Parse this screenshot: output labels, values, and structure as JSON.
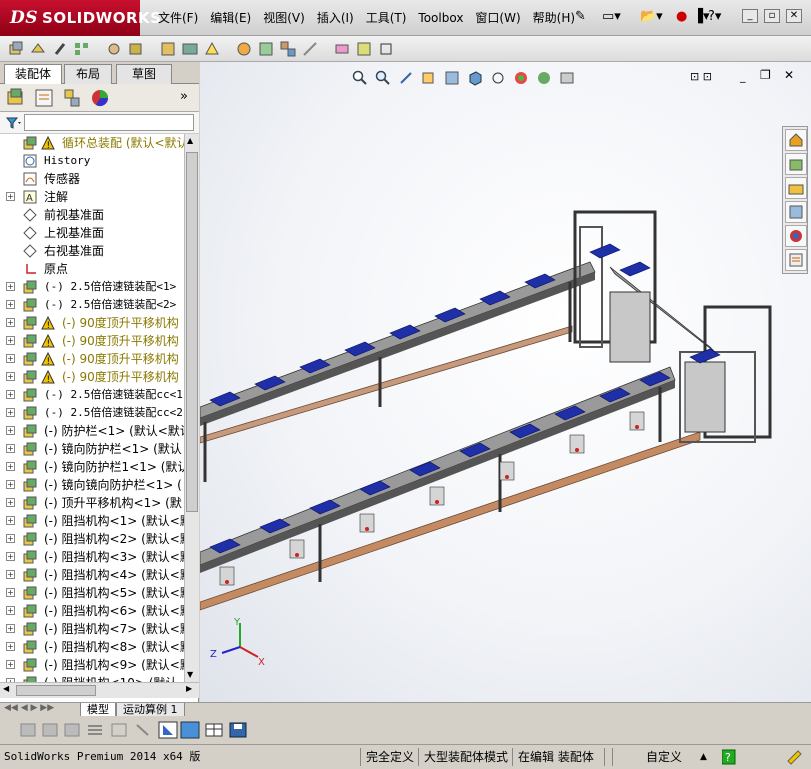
{
  "app": {
    "brand_ds": "DS",
    "brand": "SOLIDWORKS"
  },
  "menu": [
    "文件(F)",
    "编辑(E)",
    "视图(V)",
    "插入(I)",
    "工具(T)",
    "Toolbox",
    "窗口(W)",
    "帮助(H)"
  ],
  "panel_tabs": [
    "装配体",
    "布局",
    "草图"
  ],
  "tree": [
    {
      "label": "循环总装配  (默认<默认_",
      "icon": "assembly-icon",
      "warn": true,
      "exp": "",
      "warnColor": true
    },
    {
      "label": "History",
      "icon": "history-icon",
      "exp": "",
      "mono": true
    },
    {
      "label": "传感器",
      "icon": "sensor-icon",
      "exp": ""
    },
    {
      "label": "注解",
      "icon": "annotation-icon",
      "exp": "+"
    },
    {
      "label": "前视基准面",
      "icon": "plane-icon",
      "exp": ""
    },
    {
      "label": "上视基准面",
      "icon": "plane-icon",
      "exp": ""
    },
    {
      "label": "右视基准面",
      "icon": "plane-icon",
      "exp": ""
    },
    {
      "label": "原点",
      "icon": "origin-icon",
      "exp": ""
    },
    {
      "label": "(-) 2.5倍倍速链装配<1>",
      "icon": "subassembly-icon",
      "exp": "+",
      "mono": true
    },
    {
      "label": "(-) 2.5倍倍速链装配<2>",
      "icon": "subassembly-icon",
      "exp": "+",
      "mono": true
    },
    {
      "label": "(-) 90度顶升平移机构",
      "icon": "subassembly-icon",
      "exp": "+",
      "warn": true,
      "warnColor": true
    },
    {
      "label": "(-) 90度顶升平移机构",
      "icon": "subassembly-icon",
      "exp": "+",
      "warn": true,
      "warnColor": true
    },
    {
      "label": "(-) 90度顶升平移机构",
      "icon": "subassembly-icon",
      "exp": "+",
      "warn": true,
      "warnColor": true
    },
    {
      "label": "(-) 90度顶升平移机构",
      "icon": "subassembly-icon",
      "exp": "+",
      "warn": true,
      "warnColor": true
    },
    {
      "label": "(-) 2.5倍倍速链装配cc<1",
      "icon": "subassembly-icon",
      "exp": "+",
      "mono": true
    },
    {
      "label": "(-) 2.5倍倍速链装配cc<2",
      "icon": "subassembly-icon",
      "exp": "+",
      "mono": true
    },
    {
      "label": "(-) 防护栏<1> (默认<默认",
      "icon": "subassembly-icon",
      "exp": "+"
    },
    {
      "label": "(-) 镜向防护栏<1> (默认",
      "icon": "subassembly-icon",
      "exp": "+"
    },
    {
      "label": "(-) 镜向防护栏1<1> (默认",
      "icon": "subassembly-icon",
      "exp": "+"
    },
    {
      "label": "(-) 镜向镜向防护栏<1> (",
      "icon": "subassembly-icon",
      "exp": "+"
    },
    {
      "label": "(-) 顶升平移机构<1> (默",
      "icon": "subassembly-icon",
      "exp": "+"
    },
    {
      "label": "(-) 阻挡机构<1> (默认<默",
      "icon": "subassembly-icon",
      "exp": "+"
    },
    {
      "label": "(-) 阻挡机构<2> (默认<默",
      "icon": "subassembly-icon",
      "exp": "+"
    },
    {
      "label": "(-) 阻挡机构<3> (默认<默",
      "icon": "subassembly-icon",
      "exp": "+"
    },
    {
      "label": "(-) 阻挡机构<4> (默认<默",
      "icon": "subassembly-icon",
      "exp": "+"
    },
    {
      "label": "(-) 阻挡机构<5> (默认<默",
      "icon": "subassembly-icon",
      "exp": "+"
    },
    {
      "label": "(-) 阻挡机构<6> (默认<默",
      "icon": "subassembly-icon",
      "exp": "+"
    },
    {
      "label": "(-) 阻挡机构<7> (默认<默",
      "icon": "subassembly-icon",
      "exp": "+"
    },
    {
      "label": "(-) 阻挡机构<8> (默认<默",
      "icon": "subassembly-icon",
      "exp": "+"
    },
    {
      "label": "(-) 阻挡机构<9> (默认<默",
      "icon": "subassembly-icon",
      "exp": "+"
    },
    {
      "label": "(-) 阻挡机构<10> (默认",
      "icon": "subassembly-icon",
      "exp": "+"
    }
  ],
  "bottom_tabs": [
    "模型",
    "运动算例 1"
  ],
  "triad": {
    "x": "X",
    "y": "Y",
    "z": "Z"
  },
  "status": {
    "app_version": "SolidWorks Premium 2014 x64 版",
    "definition": "完全定义",
    "mode": "大型装配体模式",
    "editing": "在编辑 装配体",
    "units": "自定义"
  },
  "colors": {
    "brand_red": "#c8102e",
    "conveyor_blue": "#1f2fa8",
    "frame_gray": "#8c8c8c",
    "rail_brown": "#b98260",
    "warning_yellow": "#f2c400"
  }
}
